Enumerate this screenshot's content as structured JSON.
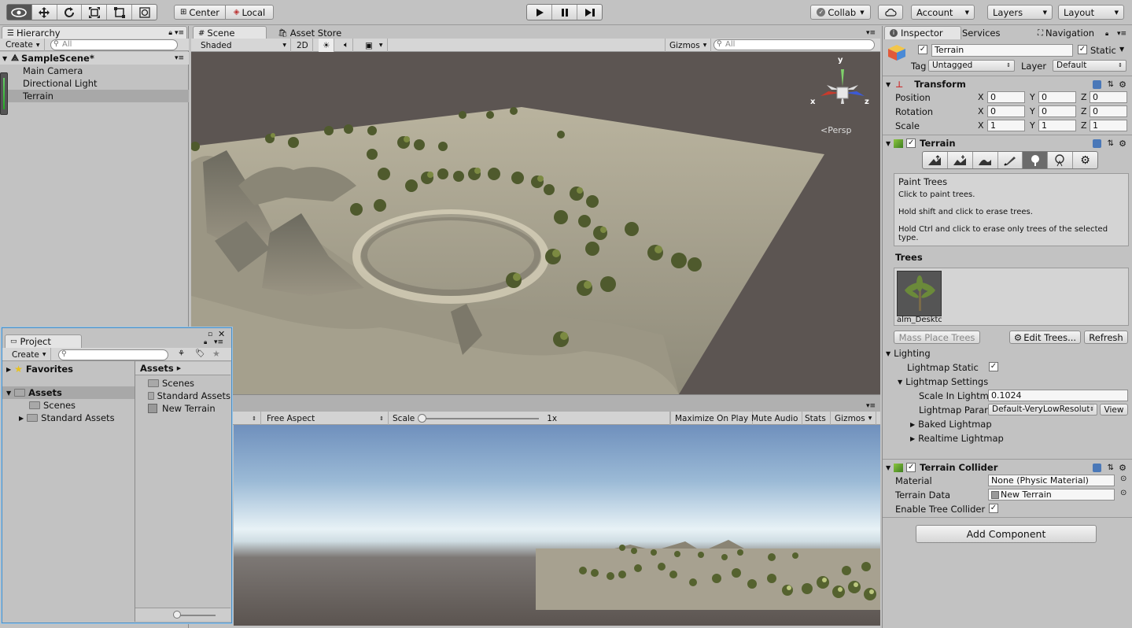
{
  "toolbar": {
    "pivot": "Center",
    "space": "Local",
    "collab": "Collab",
    "account": "Account",
    "layers": "Layers",
    "layout": "Layout"
  },
  "hierarchy": {
    "tab": "Hierarchy",
    "create": "Create",
    "search_placeholder": "All",
    "scene": "SampleScene*",
    "items": [
      "Main Camera",
      "Directional Light",
      "Terrain"
    ]
  },
  "scene_view": {
    "tabs": [
      "Scene",
      "Asset Store"
    ],
    "shading": "Shaded",
    "mode_2d": "2D",
    "gizmos": "Gizmos",
    "search_placeholder": "All",
    "persp_label": "Persp",
    "axis_y": "y",
    "axis_x": "x",
    "axis_z": "z"
  },
  "game_view": {
    "aspect": "Free Aspect",
    "scale_label": "Scale",
    "scale_value": "1x",
    "buttons": [
      "Maximize On Play",
      "Mute Audio",
      "Stats",
      "Gizmos"
    ]
  },
  "project": {
    "tab": "Project",
    "create": "Create",
    "favorites": "Favorites",
    "assets_root": "Assets",
    "tree": [
      "Scenes",
      "Standard Assets"
    ],
    "breadcrumb": "Assets",
    "files": [
      "Scenes",
      "Standard Assets",
      "New Terrain"
    ]
  },
  "inspector": {
    "tabs": [
      "Inspector",
      "Services",
      "Navigation"
    ],
    "object_name": "Terrain",
    "static_label": "Static",
    "tag_label": "Tag",
    "tag_value": "Untagged",
    "layer_label": "Layer",
    "layer_value": "Default",
    "transform": {
      "title": "Transform",
      "position_label": "Position",
      "rotation_label": "Rotation",
      "scale_label": "Scale",
      "position": [
        "0",
        "0",
        "0"
      ],
      "rotation": [
        "0",
        "0",
        "0"
      ],
      "scale": [
        "1",
        "1",
        "1"
      ],
      "axes": [
        "X",
        "Y",
        "Z"
      ]
    },
    "terrain": {
      "title": "Terrain",
      "help_title": "Paint Trees",
      "help_lines": [
        "Click to paint trees.",
        "Hold shift and click to erase trees.",
        "Hold Ctrl and click to erase only trees of the selected type."
      ],
      "trees_label": "Trees",
      "tree_asset": "alm_Desktc",
      "mass_place": "Mass Place Trees",
      "edit_trees": "Edit Trees...",
      "refresh": "Refresh",
      "lighting": "Lighting",
      "lightmap_static": "Lightmap Static",
      "lightmap_settings": "Lightmap Settings",
      "scale_in_lightmap": "Scale In Lightm",
      "scale_in_lightmap_value": "0.1024",
      "lightmap_params": "Lightmap Parar",
      "lightmap_params_value": "Default-VeryLowResolut",
      "view": "View",
      "baked_lightmap": "Baked Lightmap",
      "realtime_lightmap": "Realtime Lightmap"
    },
    "collider": {
      "title": "Terrain Collider",
      "material_label": "Material",
      "material_value": "None (Physic Material)",
      "data_label": "Terrain Data",
      "data_value": "New Terrain",
      "enable_trees": "Enable Tree Collider"
    },
    "add_component": "Add Component"
  },
  "colors": {
    "sky_top": "#6d8fbf",
    "sky_horizon": "#e8f2f6",
    "ground": "#5b5450",
    "terrain": "#a9a48f",
    "selection": "#a8a8a8"
  }
}
